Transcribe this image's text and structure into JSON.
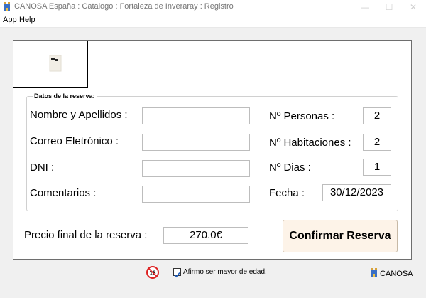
{
  "window": {
    "title": "CANOSA España : Catalogo : Fortaleza de Inveraray : Registro"
  },
  "menu": {
    "items": [
      {
        "label": "App"
      },
      {
        "label": "Help"
      }
    ]
  },
  "form": {
    "group_legend": "Datos de la reserva:",
    "name_label": "Nombre y Apellidos :",
    "email_label": "Correo Eletrónico :",
    "dni_label": "DNI :",
    "comments_label": "Comentarios :",
    "name_value": "",
    "email_value": "",
    "dni_value": "",
    "comments_value": "",
    "personas_label": "Nº Personas :",
    "personas_value": "2",
    "habitaciones_label": "Nº Habitaciones :",
    "habitaciones_value": "2",
    "dias_label": "Nº Dias :",
    "dias_value": "1",
    "fecha_label": "Fecha :",
    "fecha_value": "30/12/2023"
  },
  "pricing": {
    "label": "Precio final de la reserva :",
    "value": "270.0€"
  },
  "actions": {
    "confirm_label": "Confirmar Reserva"
  },
  "footer": {
    "age_badge": "18",
    "age_checkbox_label": "Afirmo ser mayor de edad.",
    "age_checked": true,
    "brand": "CANOSA"
  },
  "icons": {
    "app": "castle-flag-icon",
    "logo": "document-icon",
    "age": "no-under-18-icon"
  }
}
